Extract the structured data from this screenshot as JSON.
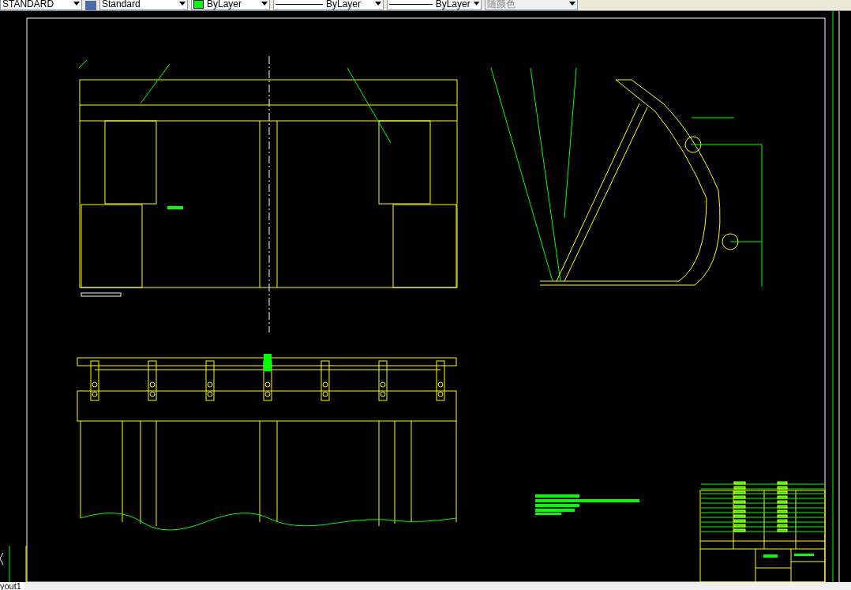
{
  "toolbar": {
    "dropdowns": [
      {
        "kind": "text",
        "value": "STANDARD"
      },
      {
        "kind": "style",
        "value": "Standard"
      },
      {
        "kind": "swatch",
        "value": "ByLayer"
      },
      {
        "kind": "linetype",
        "value": "ByLayer"
      },
      {
        "kind": "linetype",
        "value": "ByLayer"
      },
      {
        "kind": "disabled",
        "value": "随颜色"
      }
    ]
  },
  "layout_tabs": [
    {
      "label": "yout1",
      "selected": true
    }
  ]
}
